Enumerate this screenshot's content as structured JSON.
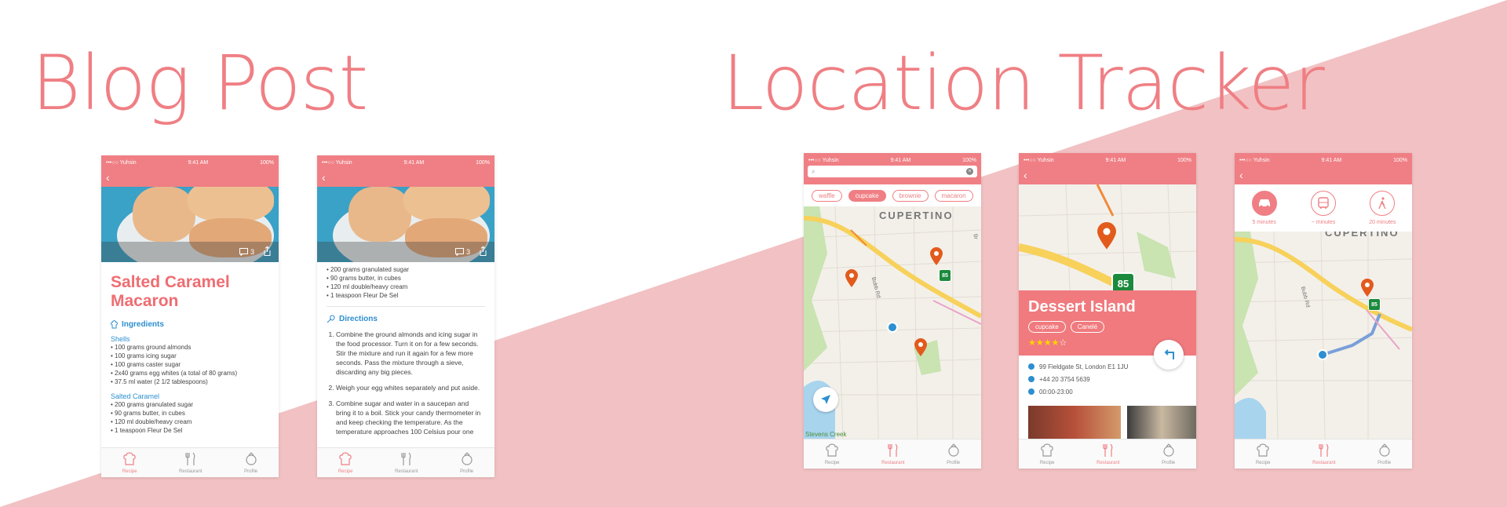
{
  "headlines": {
    "blog": "Blog Post",
    "tracker": "Location Tracker"
  },
  "status": {
    "carrier": "•••○○ Yuhsin",
    "time": "9:41 AM",
    "battery": "100%"
  },
  "tabs": {
    "recipe": "Recipe",
    "restaurant": "Restaurant",
    "profile": "Profile"
  },
  "colors": {
    "accent": "#EF7F84",
    "blue": "#2D8FD0",
    "background_tri": "#F2C1C3"
  },
  "icons": {
    "back": "chevron-left-icon",
    "comment": "comment-icon",
    "share": "share-icon",
    "chef": "chef-hat-icon",
    "utensils": "fork-knife-icon",
    "profile": "profile-icon",
    "locate": "navigation-arrow-icon",
    "turn": "turn-left-icon",
    "pin": "map-pin-icon"
  },
  "blog1": {
    "comment_count": "3",
    "title_line1": "Salted Caramel",
    "title_line2": "Macaron",
    "ingredients_heading": "Ingredients",
    "shells_heading": "Shells",
    "shells": [
      "100 grams ground almonds",
      "100 grams icing sugar",
      "100 grams caster sugar",
      "2x40 grams egg whites (a total of 80 grams)",
      "37.5 ml water (2 1/2 tablespoons)"
    ],
    "caramel_heading": "Salted Caramel",
    "caramel": [
      "200 grams granulated sugar",
      "90 grams butter, in cubes",
      "120 ml double/heavy cream",
      "1 teaspoon Fleur De Sel"
    ]
  },
  "blog2": {
    "comment_count": "3",
    "caramel": [
      "200 grams granulated sugar",
      "90 grams butter, in cubes",
      "120 ml double/heavy cream",
      "1 teaspoon Fleur De Sel"
    ],
    "directions_heading": "Directions",
    "steps": [
      "Combine the ground almonds and icing sugar in the food processor. Turn it on for a few seconds. Stir the mixture and run it again for a few more seconds. Pass the mixture through a sieve, discarding any big pieces.",
      "Weigh your egg whites separately and put aside.",
      "Combine sugar and water in a saucepan and bring it to a boil. Stick your candy thermometer in and keep checking the temperature. As the temperature approaches 100 Celsius pour one"
    ]
  },
  "map1": {
    "chips": [
      "waffle",
      "cupcake",
      "brownie",
      "macaron"
    ],
    "active_chip": "cupcake",
    "city": "CUPERTINO",
    "street": "Bubb Rd",
    "street2": "Br",
    "shield": "85",
    "bottom_label": "Stevens Creek"
  },
  "map2": {
    "shield": "85",
    "name": "Dessert Island",
    "tags": [
      "cupcake",
      "Canelé"
    ],
    "rating": 4,
    "rating_max": 5,
    "address": "99 Fieldgate St, London E1 1JU",
    "phone": "+44 20 3754 5639",
    "hours": "00:00-23:00"
  },
  "map3": {
    "modes": [
      {
        "label": "5 minutes",
        "icon": "car-icon"
      },
      {
        "label": "~ minutes",
        "icon": "bus-icon"
      },
      {
        "label": "20 minutes",
        "icon": "walk-icon"
      }
    ],
    "city": "CUPERTINO",
    "street": "Bubb Rd",
    "shield": "85"
  }
}
